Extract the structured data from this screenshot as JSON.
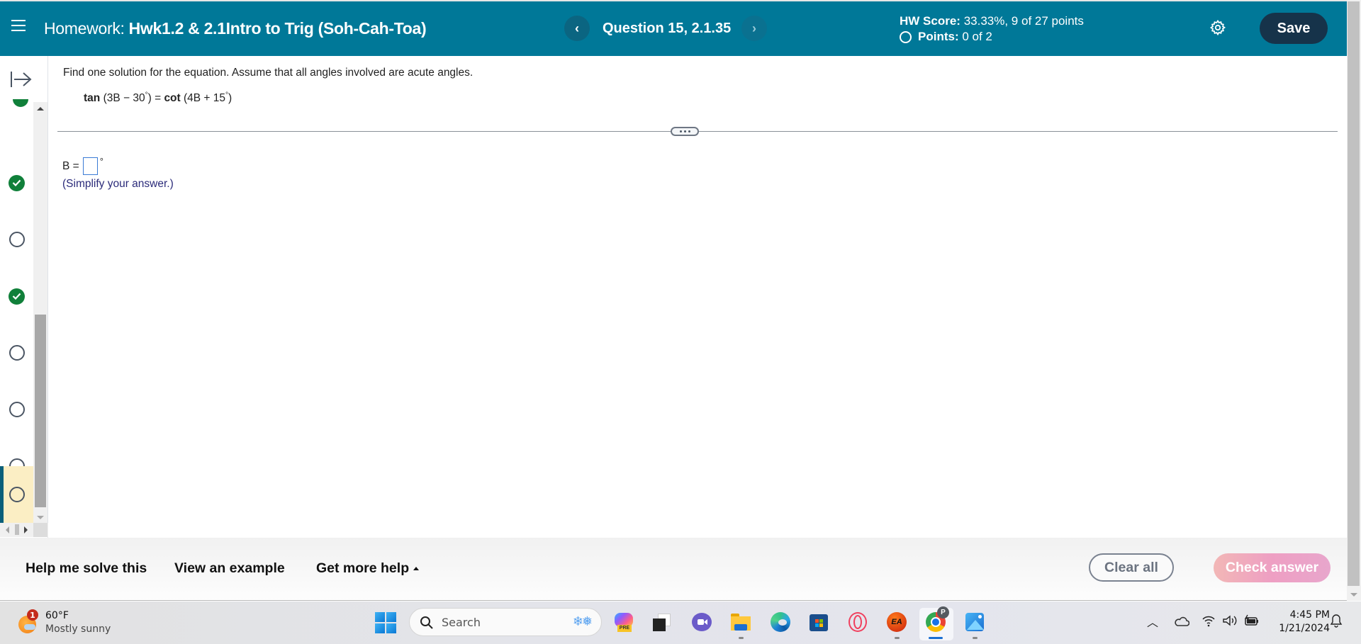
{
  "header": {
    "homework_label": "Homework:",
    "homework_name": "Hwk1.2 & 2.1Intro to Trig (Soh-Cah-Toa)",
    "question_label": "Question 15, 2.1.35",
    "prev_glyph": "‹",
    "next_glyph": "›",
    "hw_score_label": "HW Score:",
    "hw_score_value": "33.33%, 9 of 27 points",
    "points_label": "Points:",
    "points_value": "0 of 2",
    "save_label": "Save"
  },
  "question_list": {
    "items": [
      {
        "status": "correct",
        "partial": true
      },
      {
        "status": "correct"
      },
      {
        "status": "unanswered"
      },
      {
        "status": "correct"
      },
      {
        "status": "unanswered"
      },
      {
        "status": "unanswered"
      },
      {
        "status": "unanswered"
      },
      {
        "status": "unanswered",
        "current": true
      }
    ]
  },
  "question": {
    "instruction": "Find one solution for the equation. Assume that all angles involved are acute angles.",
    "equation": {
      "lhs_fn": "tan",
      "lhs_arg_open": "(3B − 30",
      "lhs_arg_close": ")",
      "equals": " = ",
      "rhs_fn": "cot",
      "rhs_arg_open": "(4B + 15",
      "rhs_arg_close": ")",
      "degree": "°"
    },
    "answer_label": "B =",
    "answer_value": "",
    "answer_unit": "°",
    "hint": "(Simplify your answer.)"
  },
  "footer": {
    "help_me_solve": "Help me solve this",
    "view_example": "View an example",
    "get_more_help": "Get more help",
    "clear_all": "Clear all",
    "check_answer": "Check answer"
  },
  "taskbar": {
    "weather_badge": "1",
    "temperature": "60°F",
    "condition": "Mostly sunny",
    "search_placeholder": "Search",
    "copilot_badge": "PRE",
    "chrome_profile": "P",
    "ea_label": "EA",
    "time": "4:45 PM",
    "date": "1/21/2024"
  },
  "colors": {
    "header_bg": "#007898",
    "save_bg": "#16334a",
    "correct_green": "#10803a",
    "current_highlight": "#fbeec4"
  }
}
